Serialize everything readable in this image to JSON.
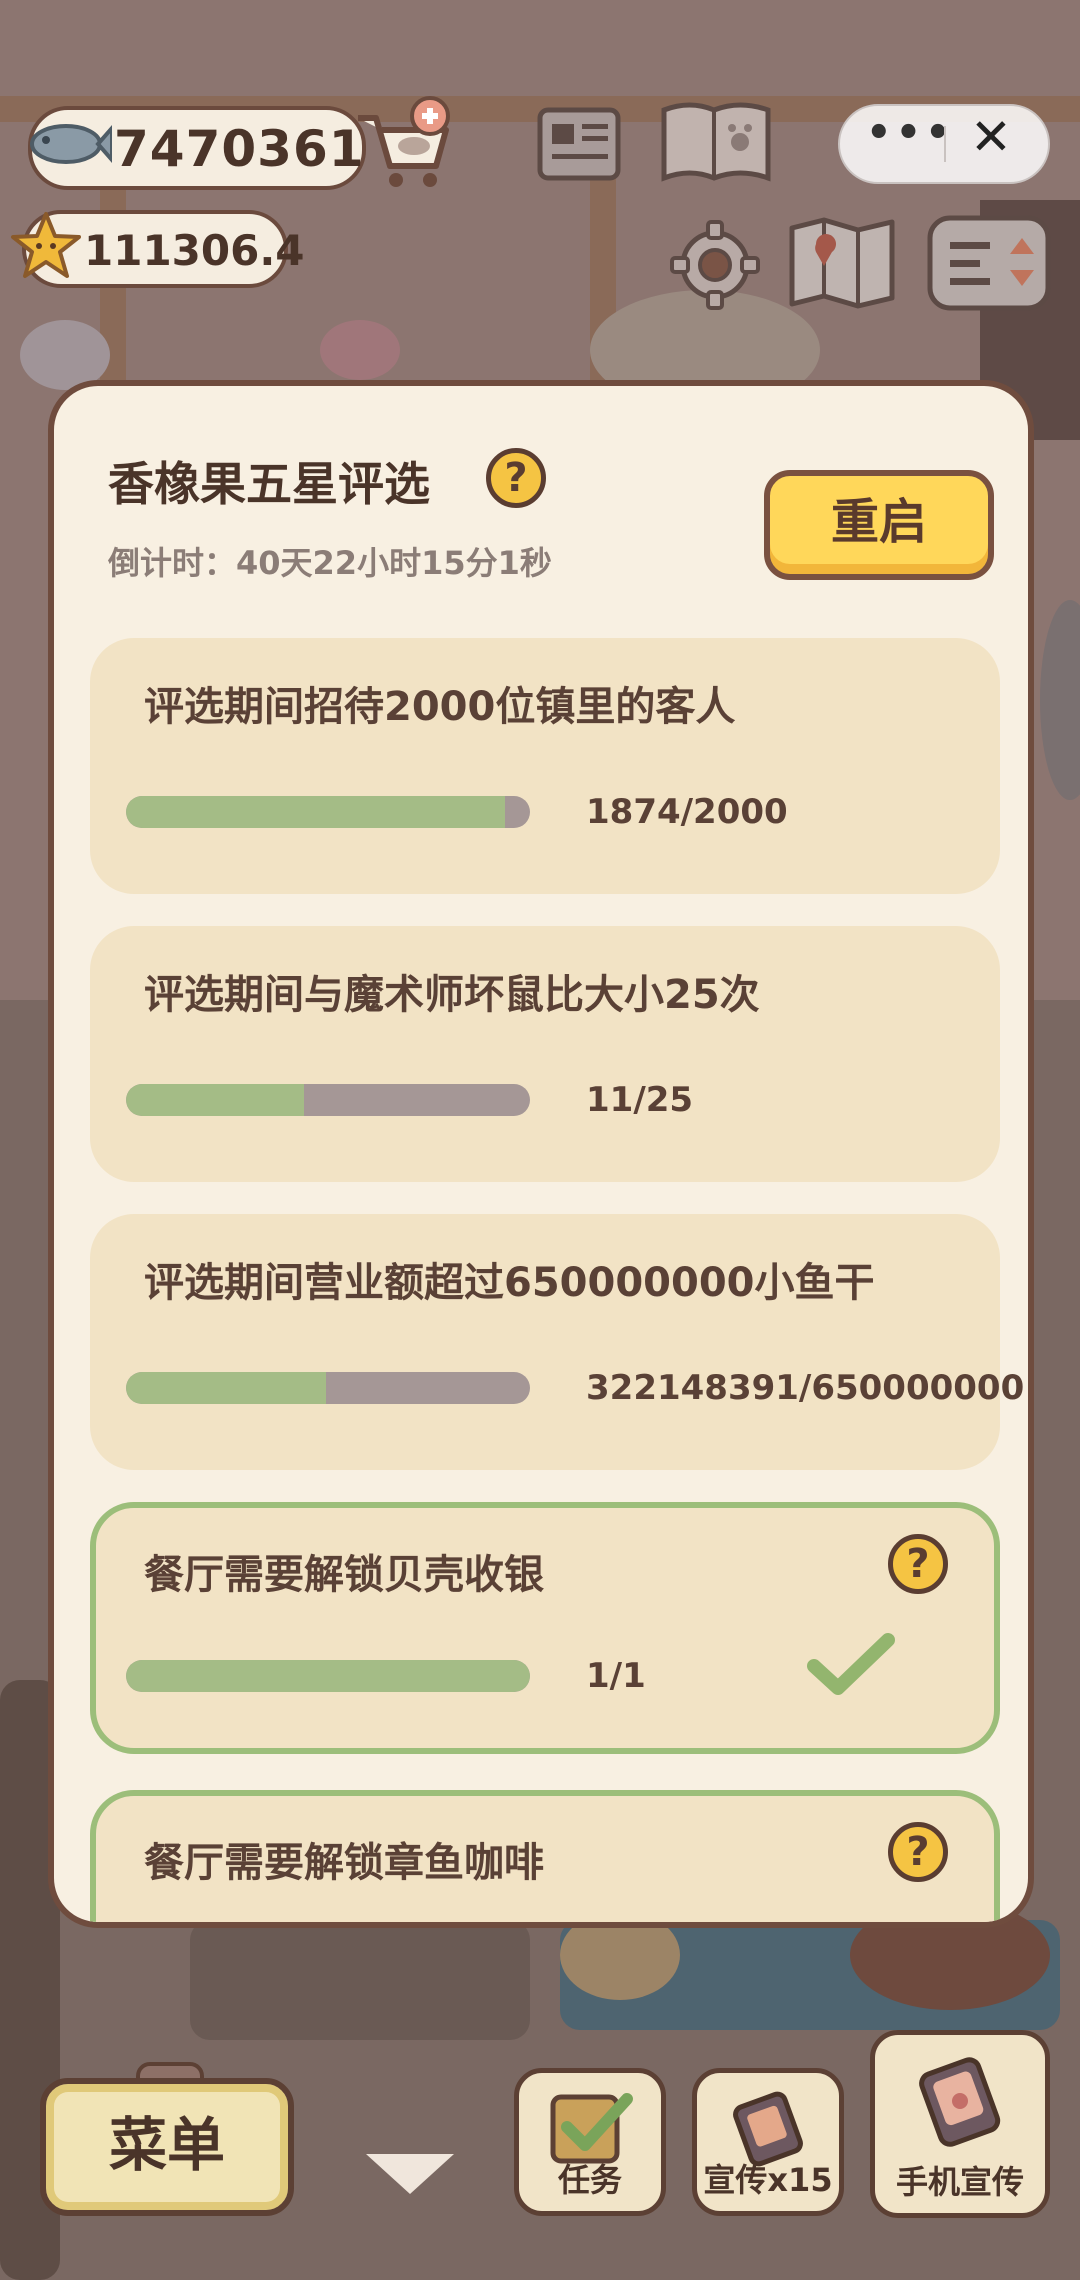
{
  "hud": {
    "fish_count": "7470361",
    "star_count": "111306.4",
    "icons": [
      "fish-icon",
      "shop-cart-plus-icon",
      "newspaper-icon",
      "paw-album-icon",
      "settings-gear-icon",
      "map-icon",
      "sort-list-icon",
      "star-face-icon"
    ]
  },
  "wechat_capsule": {
    "more": "•••",
    "close": "✕"
  },
  "dialog": {
    "title": "香橡果五星评选",
    "countdown": "倒计时：40天22小时15分1秒",
    "restart_label": "重启",
    "tasks": [
      {
        "text": "评选期间招待2000位镇里的客人",
        "progress_text": "1874/2000",
        "progress": 0.937,
        "completed": false
      },
      {
        "text": "评选期间与魔术师坏鼠比大小25次",
        "progress_text": "11/25",
        "progress": 0.44,
        "completed": false
      },
      {
        "text": "评选期间营业额超过650000000小鱼干",
        "progress_text": "322148391/650000000",
        "progress": 0.4956,
        "completed": false
      },
      {
        "text": "餐厅需要解锁贝壳收银",
        "progress_text": "1/1",
        "progress": 1.0,
        "completed": true
      },
      {
        "text": "餐厅需要解锁章鱼咖啡",
        "progress_text": "",
        "progress": 0,
        "completed": true
      }
    ]
  },
  "bottom_bar": {
    "menu_label": "菜单",
    "task_label": "任务",
    "promo_label": "宣传x15",
    "phone_promo_label": "手机宣传"
  },
  "colors": {
    "progress_fill": "#a4bc86",
    "progress_track": "#a59796",
    "card_bg": "#f2e3c5",
    "done_border": "#9cbe7a",
    "restart_button": "#ffd75a",
    "help_icon": "#f5c443"
  }
}
